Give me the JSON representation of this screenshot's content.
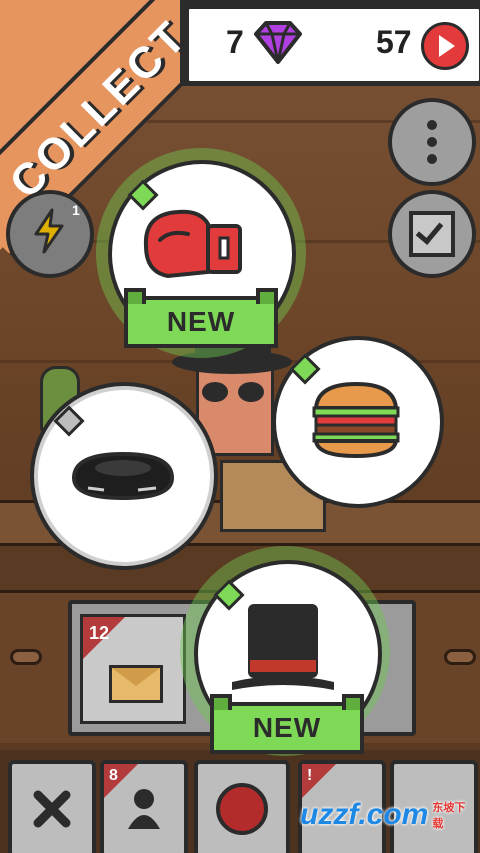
{
  "hud": {
    "gem_count": "7",
    "coin_count": "57",
    "gem_icon": "purple-gem-icon",
    "coin_icon": "red-play-coin-icon"
  },
  "banner": {
    "label": "COLLECT"
  },
  "side_buttons": {
    "menu_icon": "vertical-dots-icon",
    "check_icon": "checkbox-icon",
    "energy_icon": "lightning-icon",
    "energy_badge": "1"
  },
  "items": [
    {
      "name": "boxing-glove",
      "badge": "NEW",
      "rarity": "green"
    },
    {
      "name": "burger",
      "badge": "",
      "rarity": "green"
    },
    {
      "name": "black-bag",
      "badge": "",
      "rarity": "gray"
    },
    {
      "name": "top-hat",
      "badge": "NEW",
      "rarity": "green"
    }
  ],
  "panel": {
    "slot_count": "12"
  },
  "toolbar": {
    "close_icon": "close-icon",
    "user_badge": "8",
    "user_icon": "person-icon",
    "record_icon": "red-circle-icon",
    "alert_badge": "!"
  },
  "watermark": {
    "text": "uzzf.com",
    "sub": "东坡下载"
  },
  "colors": {
    "accent_orange": "#e6955f",
    "new_green": "#7ed957",
    "alert_red": "#e33b3b"
  }
}
